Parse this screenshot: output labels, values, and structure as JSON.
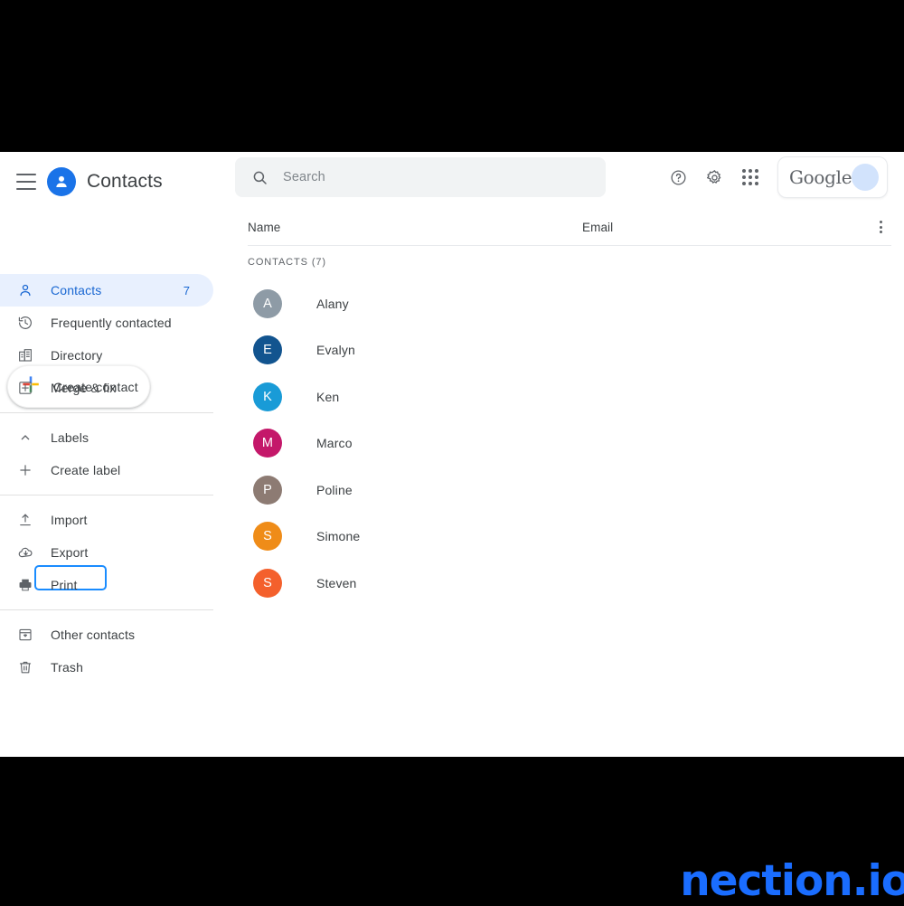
{
  "app": {
    "title": "Contacts",
    "logo_icon": "contacts-person-icon",
    "menu_icon": "hamburger-menu-icon"
  },
  "sidebar": {
    "create_button": {
      "label": "Create contact",
      "icon": "google-plus-icon"
    },
    "items": [
      {
        "label": "Contacts",
        "icon": "person-icon",
        "count": "7",
        "selected": true
      },
      {
        "label": "Frequently contacted",
        "icon": "history-clock-icon",
        "count": "",
        "selected": false
      },
      {
        "label": "Directory",
        "icon": "building-icon",
        "count": "",
        "selected": false
      },
      {
        "label": "Merge & fix",
        "icon": "merge-fix-icon",
        "count": "",
        "selected": false
      }
    ],
    "labels_group": [
      {
        "label": "Labels",
        "icon": "chevron-up-icon"
      },
      {
        "label": "Create label",
        "icon": "plus-icon"
      }
    ],
    "tools_group": [
      {
        "label": "Import",
        "icon": "upload-icon",
        "focused": false
      },
      {
        "label": "Export",
        "icon": "cloud-download-icon",
        "focused": false
      },
      {
        "label": "Print",
        "icon": "printer-icon",
        "focused": true
      }
    ],
    "bottom_group": [
      {
        "label": "Other contacts",
        "icon": "archive-box-icon"
      },
      {
        "label": "Trash",
        "icon": "trash-icon"
      }
    ]
  },
  "topbar": {
    "search": {
      "placeholder": "Search",
      "value": "",
      "icon": "search-icon"
    },
    "help_icon": "help-circle-icon",
    "settings_icon": "gear-icon",
    "apps_icon": "apps-grid-icon",
    "account": {
      "brand": "Google",
      "avatar_icon": "account-avatar"
    }
  },
  "table": {
    "columns": {
      "name": "Name",
      "email": "Email"
    },
    "more_icon": "more-vertical-icon",
    "section_label": "CONTACTS (7)",
    "rows": [
      {
        "initial": "A",
        "name": "Alany",
        "email": "",
        "color": "#8e9ba6"
      },
      {
        "initial": "E",
        "name": "Evalyn",
        "email": "",
        "color": "#12548f"
      },
      {
        "initial": "K",
        "name": "Ken",
        "email": "",
        "color": "#199bd7"
      },
      {
        "initial": "M",
        "name": "Marco",
        "email": "",
        "color": "#c4186a"
      },
      {
        "initial": "P",
        "name": "Poline",
        "email": "",
        "color": "#8d7b73"
      },
      {
        "initial": "S",
        "name": "Simone",
        "email": "",
        "color": "#ef8c18"
      },
      {
        "initial": "S",
        "name": "Steven",
        "email": "",
        "color": "#f4602c"
      }
    ]
  },
  "watermark": {
    "text": "nection.io",
    "color": "#1a6dff"
  },
  "theme": {
    "accent": "#1a73e8",
    "selected_bg": "#e8f0fe",
    "focus_ring": "#1a8cff"
  }
}
